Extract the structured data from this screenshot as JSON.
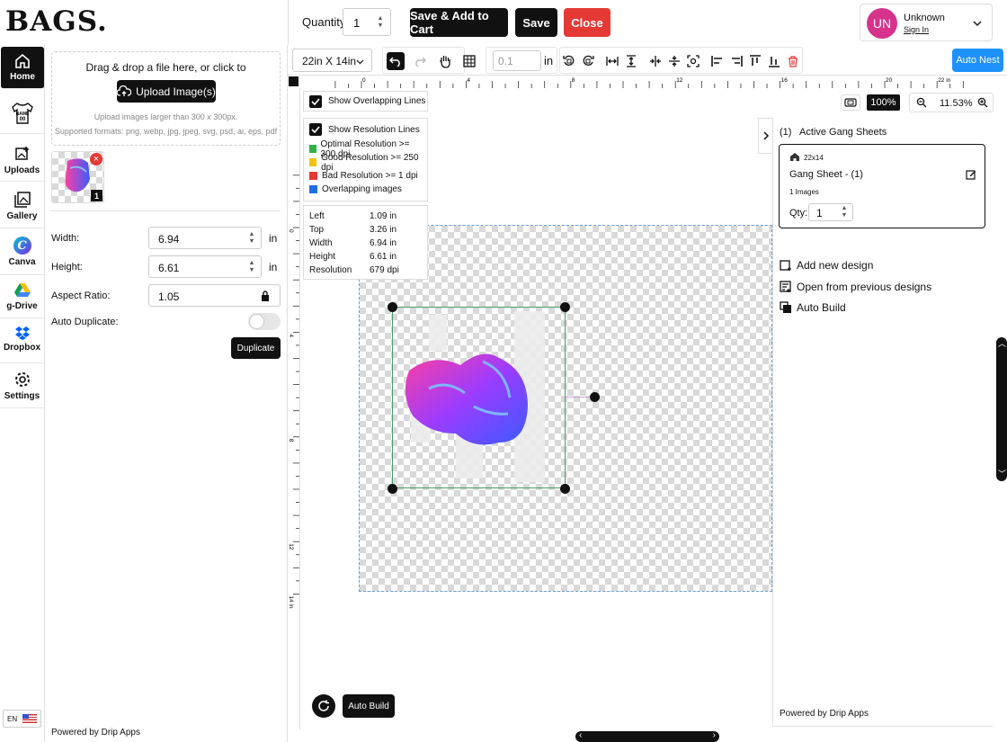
{
  "brand": {
    "logo": "BAGS."
  },
  "header": {
    "quantity_label": "Quantity:",
    "quantity_value": "1",
    "save_add_label": "Save & Add to Cart",
    "save_label": "Save",
    "close_label": "Close",
    "user_initials": "UN",
    "user_name": "Unknown",
    "user_signin": "Sign In"
  },
  "sidebar": {
    "items": [
      {
        "label": "Home",
        "icon": "home-icon"
      },
      {
        "label": "",
        "icon": "tshirt-icon"
      },
      {
        "label": "Uploads",
        "icon": "upload-icon"
      },
      {
        "label": "Gallery",
        "icon": "gallery-icon"
      },
      {
        "label": "Canva",
        "icon": "canva-icon"
      },
      {
        "label": "g-Drive",
        "icon": "gdrive-icon"
      },
      {
        "label": "Dropbox",
        "icon": "dropbox-icon"
      },
      {
        "label": "Settings",
        "icon": "gear-icon"
      }
    ],
    "lang": "EN"
  },
  "upload_panel": {
    "dropzone_text": "Drag & drop a file here, or click to",
    "upload_button": "Upload Image(s)",
    "hint_line1": "Upload images larger than 300 x 300px.",
    "hint_line2": "Supported formats: png, webp, jpg, jpeg, svg, psd, ai, eps, pdf",
    "thumb_count": "1",
    "width_label": "Width:",
    "width_value": "6.94",
    "width_unit": "in",
    "height_label": "Height:",
    "height_value": "6.61",
    "height_unit": "in",
    "aspect_label": "Aspect Ratio:",
    "aspect_value": "1.05",
    "auto_dup_label": "Auto Duplicate:",
    "auto_dup_on": false,
    "duplicate_button": "Duplicate",
    "powered_prefix": "Powered by ",
    "powered_brand": "Drip Apps"
  },
  "toolbar": {
    "size_select": "22in X 14in",
    "spacing_value": "0.1",
    "spacing_unit": "in",
    "auto_nest": "Auto Nest"
  },
  "ruler": {
    "h_labels": [
      "0",
      "4",
      "8",
      "12",
      "16",
      "20",
      "22 in"
    ],
    "v_labels": [
      "0",
      "4",
      "8",
      "12",
      "14 in"
    ]
  },
  "canvas": {
    "show_overlap": "Show Overlapping Lines",
    "show_resolution": "Show Resolution Lines",
    "legend": [
      {
        "label": "Optimal Resolution >= 300 dpi",
        "color": "#2fb344"
      },
      {
        "label": "Good Resolution >= 250 dpi",
        "color": "#f5c400"
      },
      {
        "label": "Bad Resolution >= 1 dpi",
        "color": "#e53935"
      },
      {
        "label": "Overlapping images",
        "color": "#1e6fe0"
      }
    ],
    "info": [
      {
        "k": "Left",
        "v": "1.09 in"
      },
      {
        "k": "Top",
        "v": "3.26 in"
      },
      {
        "k": "Width",
        "v": "6.94 in"
      },
      {
        "k": "Height",
        "v": "6.61 in"
      },
      {
        "k": "Resolution",
        "v": "679 dpi"
      }
    ],
    "zoom_reset": "100%",
    "zoom_value": "11.53%",
    "auto_build": "Auto Build"
  },
  "right_panel": {
    "header": "(1)   Active Gang Sheets",
    "sheet_size": "22x14",
    "sheet_name": "Gang Sheet - (1)",
    "sheet_images": "1 Images",
    "qty_label": "Qty:",
    "qty_value": "1",
    "add_new": "Add new design",
    "open_prev": "Open from previous designs",
    "auto_build": "Auto Build",
    "powered_prefix": "Powered by ",
    "powered_brand": "Drip Apps"
  }
}
